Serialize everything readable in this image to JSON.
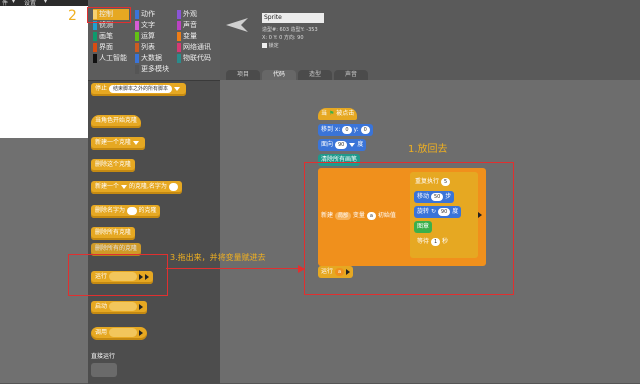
{
  "menubar": {
    "items": [
      "件",
      "▾",
      "设置",
      "▾"
    ]
  },
  "annotations": {
    "step2": "2",
    "step1": "1.放回去",
    "step3": "3.拖出来，并将变量赋进去"
  },
  "categories": [
    {
      "label": "控制",
      "color": "#e6a822"
    },
    {
      "label": "动作",
      "color": "#3a74d8"
    },
    {
      "label": "外观",
      "color": "#8a55d7"
    },
    {
      "label": "侦测",
      "color": "#20a0d0"
    },
    {
      "label": "文字",
      "color": "#d65cd6"
    },
    {
      "label": "声音",
      "color": "#bb42c3"
    },
    {
      "label": "画笔",
      "color": "#0e9a6c"
    },
    {
      "label": "运算",
      "color": "#62c213"
    },
    {
      "label": "变量",
      "color": "#ee7d16"
    },
    {
      "label": "列表",
      "color": "#cc5b22"
    },
    {
      "label": "网络通讯",
      "color": "#d63a74"
    },
    {
      "label": "界面",
      "color": "#d94d11"
    },
    {
      "label": "人工智能",
      "color": "#111111"
    },
    {
      "label": "大数据",
      "color": "#3a74d8"
    },
    {
      "label": "物联代码",
      "color": "#2a8c8c"
    },
    {
      "label": "更多模块",
      "color": "#555555"
    }
  ],
  "palette": {
    "stop": "停止",
    "stop_option": "结束脚本之外的所有脚本",
    "when_clone": "当角色开始克隆",
    "new_clone": "新建一个克隆",
    "delete_clone": "删除这个克隆",
    "new_one": "新建一个",
    "clone_name": "的克隆,名字为",
    "delete_name": "删除名字为",
    "of_clone": "的克隆",
    "delete_all": "删除所有克隆",
    "delete_of": "删除所有的克隆",
    "run": "运行",
    "launch": "启动",
    "call": "调用",
    "direct_run": "直接运行"
  },
  "sprite": {
    "name": "Sprite",
    "costume": "造型#: 603",
    "pos_line2": "造型Y: -353",
    "pos_line3": "X: 0  Y: 0  方向: 90",
    "lock": "锁定"
  },
  "tabs": [
    "项目",
    "代码",
    "造型",
    "声音"
  ],
  "script": {
    "when_clicked": "当",
    "clicked": "被点击",
    "goto": "移到 x:",
    "goto_x": "0",
    "goto_y_label": "y:",
    "goto_y": "0",
    "face": "面向",
    "face_val": "90",
    "face_unit": "度",
    "clear": "清除所有画笔",
    "newvar": "新建",
    "var_type": "局部",
    "var_label": "变量",
    "var_name": "a",
    "var_init": "初始值",
    "repeat": "重复执行",
    "repeat_val": "5",
    "move": "移动",
    "move_val": "50",
    "move_unit": "步",
    "turn": "旋转",
    "turn_val": "90",
    "turn_unit": "度",
    "stamp": "图章",
    "wait": "等待",
    "wait_val": "1",
    "wait_unit": "秒",
    "run": "运行",
    "run_arg": "a"
  }
}
